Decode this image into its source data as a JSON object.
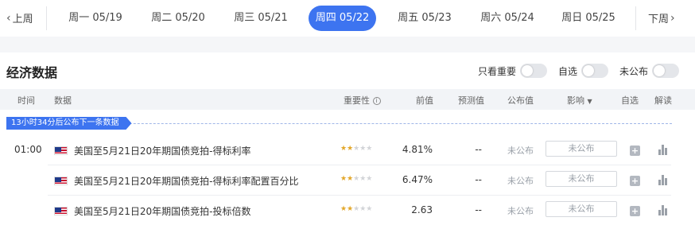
{
  "datebar": {
    "prev_label": "上周",
    "next_label": "下周",
    "days": [
      {
        "label": "周一 05/19"
      },
      {
        "label": "周二 05/20"
      },
      {
        "label": "周三 05/21"
      },
      {
        "label": "周四 05/22",
        "active": true
      },
      {
        "label": "周五 05/23"
      },
      {
        "label": "周六 05/24"
      },
      {
        "label": "周日 05/25"
      }
    ]
  },
  "section": {
    "title": "经济数据",
    "filters": [
      {
        "label": "只看重要",
        "on": false
      },
      {
        "label": "自选",
        "on": false
      },
      {
        "label": "未公布",
        "on": false
      }
    ]
  },
  "table": {
    "headers": {
      "time": "时间",
      "data": "数据",
      "importance": "重要性",
      "importance_icon": "info-icon",
      "previous": "前值",
      "forecast": "预测值",
      "actual": "公布值",
      "impact": "影响",
      "impact_icon": "caret-down-icon",
      "watchlist": "自选",
      "analysis": "解读"
    },
    "next_release_tip": "13小时34分后公布下一条数据",
    "rows": [
      {
        "time": "01:00",
        "flag": "us-flag-icon",
        "name": "美国至5月21日20年期国债竞拍-得标利率",
        "stars": 2,
        "previous": "4.81%",
        "forecast": "--",
        "actual": "未公布",
        "impact": "未公布"
      },
      {
        "time": "",
        "flag": "us-flag-icon",
        "name": "美国至5月21日20年期国债竞拍-得标利率配置百分比",
        "stars": 2,
        "previous": "6.47%",
        "forecast": "--",
        "actual": "未公布",
        "impact": "未公布"
      },
      {
        "time": "",
        "flag": "us-flag-icon",
        "name": "美国至5月21日20年期国债竞拍-投标倍数",
        "stars": 2,
        "previous": "2.63",
        "forecast": "--",
        "actual": "未公布",
        "impact": "未公布"
      }
    ]
  },
  "colors": {
    "accent": "#3d74f0",
    "star_on": "#e3a72a",
    "star_off": "#d2d4d8"
  }
}
